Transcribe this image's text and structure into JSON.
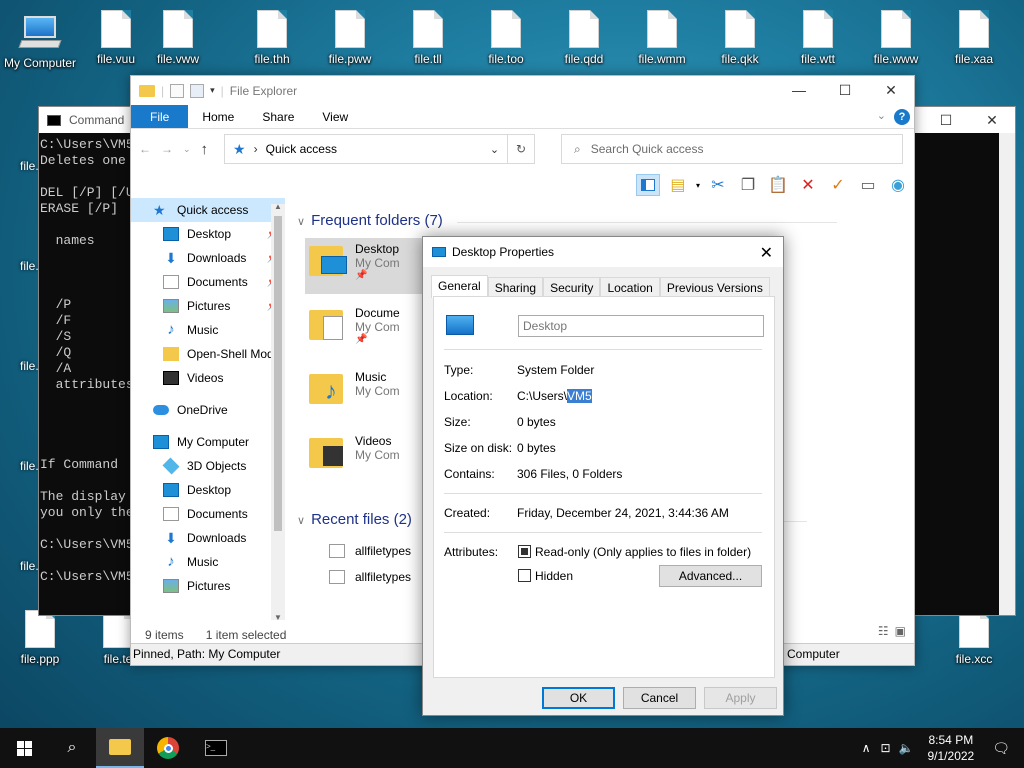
{
  "desktop_icons": [
    {
      "label": "My Computer",
      "type": "computer"
    },
    {
      "label": "file.vuu"
    },
    {
      "label": "file.vww"
    },
    {
      "label": "file.thh"
    },
    {
      "label": "file.pww"
    },
    {
      "label": "file.tll"
    },
    {
      "label": "file.too"
    },
    {
      "label": "file.qdd"
    },
    {
      "label": "file.wmm"
    },
    {
      "label": "file.qkk"
    },
    {
      "label": "file.wtt"
    },
    {
      "label": "file.www"
    },
    {
      "label": "file.xaa"
    },
    {
      "label": "file.ppp"
    },
    {
      "label": "file.te"
    },
    {
      "label": "file.xcc"
    }
  ],
  "cmd": {
    "title": "Command",
    "lines": [
      "C:\\Users\\VM5",
      "Deletes one",
      "",
      "DEL [/P] [/U",
      "ERASE [/P]",
      "",
      "  names",
      "",
      "",
      "",
      "  /P",
      "  /F",
      "  /S",
      "  /Q",
      "  /A",
      "  attributes",
      "",
      "",
      "",
      "",
      "If Command",
      "",
      "The display",
      "you only the",
      "",
      "C:\\Users\\VM5",
      "",
      "C:\\Users\\VM5"
    ],
    "side_labels": [
      "file.",
      "file.",
      "file.",
      "file.",
      "file.",
      "file."
    ]
  },
  "explorer": {
    "title": "File Explorer",
    "tabs": [
      "File",
      "Home",
      "Share",
      "View"
    ],
    "address": "Quick access",
    "search_placeholder": "Search Quick access",
    "nav": [
      {
        "label": "Quick access",
        "icon": "star-icon",
        "top": true,
        "selected": true
      },
      {
        "label": "Desktop",
        "icon": "desktop-icon",
        "pinned": true
      },
      {
        "label": "Downloads",
        "icon": "download-icon",
        "pinned": true
      },
      {
        "label": "Documents",
        "icon": "documents-icon",
        "pinned": true
      },
      {
        "label": "Pictures",
        "icon": "pictures-icon",
        "pinned": true
      },
      {
        "label": "Music",
        "icon": "music-icon"
      },
      {
        "label": "Open-Shell Mod",
        "icon": "folder-icon"
      },
      {
        "label": "Videos",
        "icon": "videos-icon"
      },
      {
        "label": "",
        "spacer": true
      },
      {
        "label": "OneDrive",
        "icon": "cloud-icon",
        "top": true
      },
      {
        "label": "",
        "spacer": true
      },
      {
        "label": "My Computer",
        "icon": "computer-icon",
        "top": true
      },
      {
        "label": "3D Objects",
        "icon": "cube-icon"
      },
      {
        "label": "Desktop",
        "icon": "desktop-icon"
      },
      {
        "label": "Documents",
        "icon": "documents-icon"
      },
      {
        "label": "Downloads",
        "icon": "download-icon"
      },
      {
        "label": "Music",
        "icon": "music-icon"
      },
      {
        "label": "Pictures",
        "icon": "pictures-icon"
      }
    ],
    "frequent_header": "Frequent folders (7)",
    "frequent": [
      {
        "name": "Desktop",
        "loc": "My Com",
        "pinned": true
      },
      {
        "name": "Docume",
        "loc": "My Com",
        "pinned": true
      },
      {
        "name": "Music",
        "loc": "My Com"
      },
      {
        "name": "Videos",
        "loc": "My Com"
      }
    ],
    "recent_header": "Recent files (2)",
    "recent": [
      "allfiletypes",
      "allfiletypes"
    ],
    "status_items": "9 items",
    "status_selected": "1 item selected",
    "tooltip": "Pinned, Path: My Computer",
    "tooltip_right": "Computer"
  },
  "dialog": {
    "title": "Desktop Properties",
    "tabs": [
      "General",
      "Sharing",
      "Security",
      "Location",
      "Previous Versions"
    ],
    "name": "Desktop",
    "type_label": "Type:",
    "type_value": "System Folder",
    "location_label": "Location:",
    "location_prefix": "C:\\Users\\",
    "location_hl": "VM5",
    "size_label": "Size:",
    "size_value": "0 bytes",
    "sizedisk_label": "Size on disk:",
    "sizedisk_value": "0 bytes",
    "contains_label": "Contains:",
    "contains_value": "306 Files, 0 Folders",
    "created_label": "Created:",
    "created_value": "Friday, December 24, 2021, 3:44:36 AM",
    "attributes_label": "Attributes:",
    "readonly_label": "Read-only (Only applies to files in folder)",
    "hidden_label": "Hidden",
    "advanced_label": "Advanced...",
    "ok": "OK",
    "cancel": "Cancel",
    "apply": "Apply"
  },
  "taskbar": {
    "time": "8:54 PM",
    "date": "9/1/2022"
  }
}
